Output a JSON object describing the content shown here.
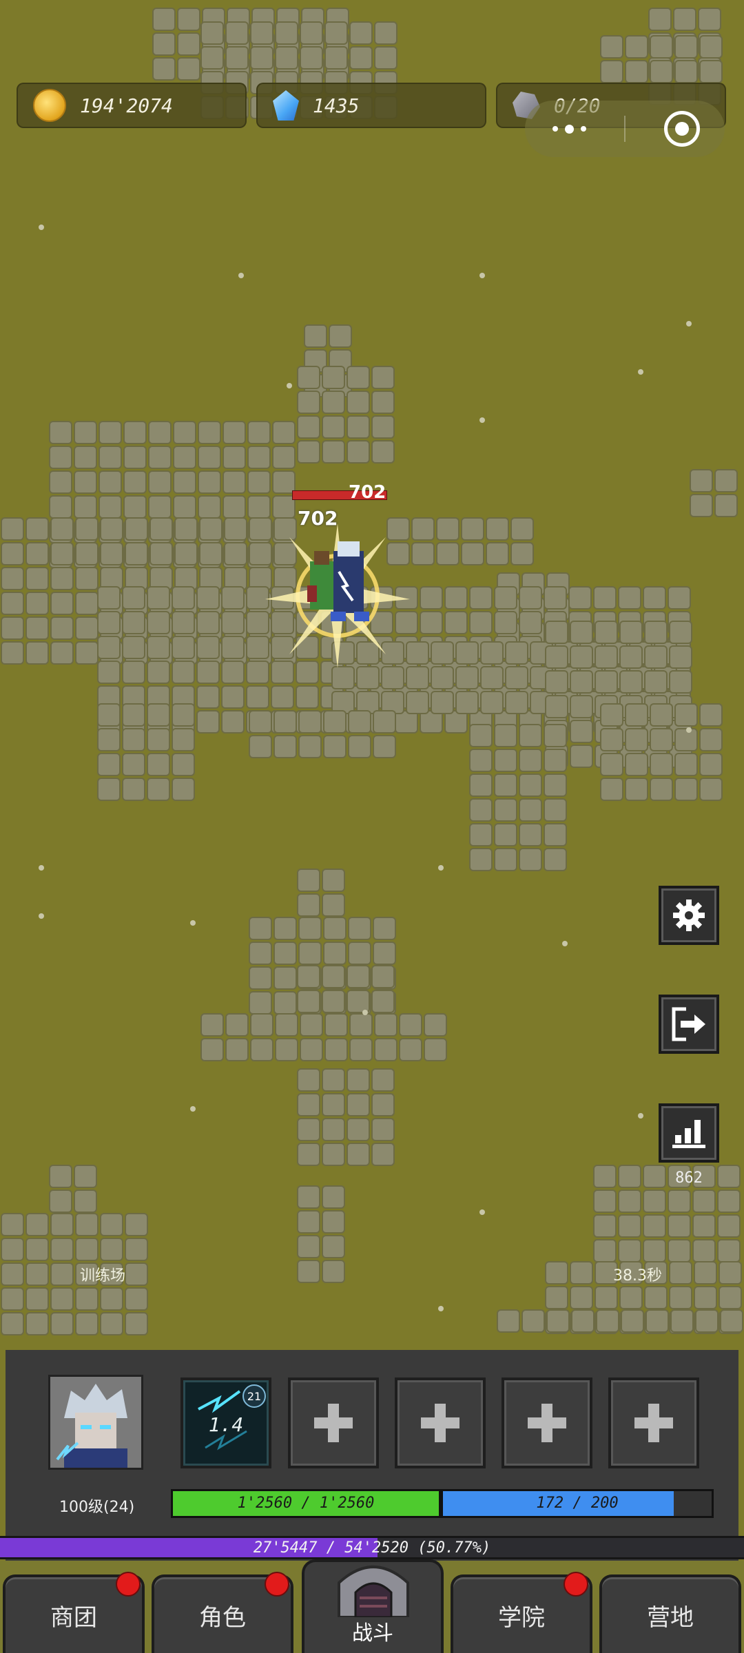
{
  "resources": {
    "gold": "194'2074",
    "crystals": "1435",
    "ore": "0/20"
  },
  "battle": {
    "damage_top": "702",
    "damage": "702",
    "enemy_hp_fraction": 1.0
  },
  "side": {
    "stats_value": "862"
  },
  "arena": {
    "name": "训练场",
    "timer": "38.3秒"
  },
  "hero": {
    "level": "100级(24)",
    "hp": "1'2560 / 1'2560",
    "hp_fraction": 1.0,
    "mp": "172 / 200",
    "mp_fraction": 0.86,
    "xp": "27'5447 / 54'2520 (50.77%)",
    "xp_fraction": 0.5077
  },
  "skills": [
    {
      "cooldown": "1.4",
      "level": "21",
      "icon": "lightning-skill-icon"
    }
  ],
  "empty_slots": 4,
  "nav": {
    "shop": "商团",
    "character": "角色",
    "battle": "战斗",
    "academy": "学院",
    "camp": "营地"
  },
  "colors": {
    "grass": "#7d7a2a",
    "hp": "#4ecb2e",
    "mp": "#3f8ef0",
    "xp": "#7a3ad6",
    "notify": "#e21b1b"
  }
}
